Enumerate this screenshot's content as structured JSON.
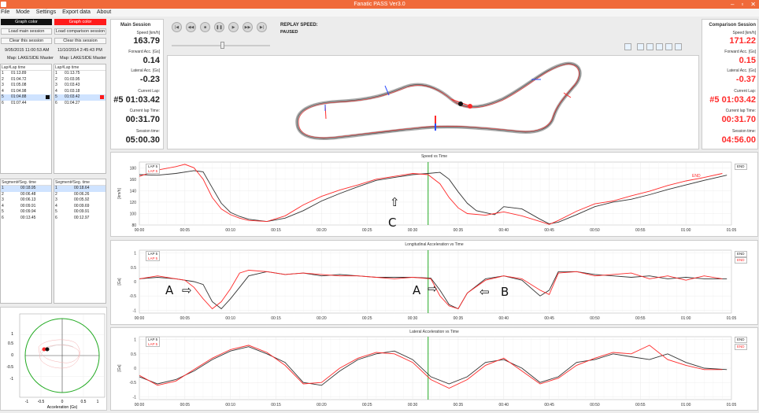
{
  "window": {
    "title": "Fanatic PASS Ver3.0",
    "controls": [
      "–",
      "▫",
      "✕"
    ]
  },
  "menu": [
    "File",
    "Mode",
    "Settings",
    "Export data",
    "About"
  ],
  "left": {
    "graph_color_main": "Graph color",
    "graph_color_comp": "Graph color",
    "load_main": "Load main session",
    "load_comp": "Load comparison session",
    "clear_main": "Clear this session",
    "clear_comp": "Clear this session",
    "main_date": "9/05/2015 11:00:53 AM",
    "comp_date": "11/10/2014 2:45:43 PM",
    "main_map": "Map: LAKESIDE Master",
    "comp_map": "Map: LAKESIDE Master",
    "lap_header_num": "Lap#",
    "lap_header_time": "Lap time",
    "main_laps": [
      {
        "n": "1",
        "t": "01:13.89"
      },
      {
        "n": "2",
        "t": "01:04.72"
      },
      {
        "n": "3",
        "t": "01:05.08"
      },
      {
        "n": "4",
        "t": "01:04.98"
      },
      {
        "n": "5",
        "t": "01:04.88"
      },
      {
        "n": "6",
        "t": "01:07.44"
      }
    ],
    "comp_laps": [
      {
        "n": "1",
        "t": "01:13.75"
      },
      {
        "n": "2",
        "t": "01:03.95"
      },
      {
        "n": "3",
        "t": "01:03.43"
      },
      {
        "n": "4",
        "t": "01:03.18"
      },
      {
        "n": "5",
        "t": "01:03.42"
      },
      {
        "n": "6",
        "t": "01:04.27"
      }
    ],
    "seg_header_num": "Segment#",
    "seg_header_time": "Seg. time",
    "main_segs": [
      {
        "n": "1",
        "t": "00:18.95"
      },
      {
        "n": "2",
        "t": "00:06.48"
      },
      {
        "n": "3",
        "t": "00:06.13"
      },
      {
        "n": "4",
        "t": "00:09.91"
      },
      {
        "n": "5",
        "t": "00:09.94"
      },
      {
        "n": "6",
        "t": "00:13.45"
      }
    ],
    "comp_segs": [
      {
        "n": "1",
        "t": "00:18.64"
      },
      {
        "n": "2",
        "t": "00:06.26"
      },
      {
        "n": "3",
        "t": "00:05.92"
      },
      {
        "n": "4",
        "t": "00:09.69"
      },
      {
        "n": "5",
        "t": "00:09.91"
      },
      {
        "n": "6",
        "t": "00:12.97"
      }
    ],
    "gg_axis": [
      "1",
      "0.5",
      "0",
      "-0.5",
      "-1"
    ],
    "gg_xaxis": [
      "-1",
      "-0.5",
      "0",
      "0.5",
      "1"
    ],
    "gg_xlabel": "Acceleration (Gs)"
  },
  "main_session": {
    "title": "Main Session",
    "speed_lbl": "Speed [km/h]",
    "speed": "163.79",
    "fwd_lbl": "Forward Acc. [Gs]",
    "fwd": "0.14",
    "lat_lbl": "Lateral Acc. [Gs]",
    "lat": "-0.23",
    "lap_lbl": "Current Lap:",
    "lap": "#5 01:03.42",
    "laptime_lbl": "Current lap Time:",
    "laptime": "00:31.70",
    "session_lbl": "Session time:",
    "session": "05:00.30"
  },
  "comp_session": {
    "title": "Comparison Session",
    "speed_lbl": "Speed [km/h]",
    "speed": "171.22",
    "fwd_lbl": "Forward Acc. [Gs]",
    "fwd": "0.15",
    "lat_lbl": "Lateral Acc. [Gs]",
    "lat": "-0.37",
    "lap_lbl": "Current Lap:",
    "lap": "#5 01:03.42",
    "laptime_lbl": "Current lap Time:",
    "laptime": "00:31.70",
    "session_lbl": "Session time:",
    "session": "04:56.00"
  },
  "replay": {
    "speed_label": "REPLAY SPEED:",
    "state": "PAUSED"
  },
  "colors": {
    "main": "#333333",
    "comp": "#ff2a2a",
    "cursor": "#22aa22",
    "titlebar": "#f06a3a"
  },
  "charts": {
    "speed_title": "Speed vs Time",
    "long_title": "Longitudinal Acceleration vs Time",
    "lat_title": "Lateral Acceleration vs Time",
    "legend_main": "LAP 5",
    "legend_comp": "LAP 5",
    "end": "END",
    "speed_unit": "[km/h]",
    "g_unit": "[Gs]",
    "speed_yticks": [
      "180",
      "160",
      "140",
      "120",
      "100",
      "80"
    ],
    "long_yticks": [
      "1",
      "0.5",
      "0",
      "-0.5",
      "-1"
    ],
    "lat_yticks": [
      "1",
      "0.5",
      "0",
      "-0.5",
      "-1"
    ],
    "xticks": [
      "00:00",
      "00:05",
      "00:10",
      "00:15",
      "00:20",
      "00:25",
      "00:30",
      "00:35",
      "00:40",
      "00:45",
      "00:50",
      "00:55",
      "01:00",
      "01:05"
    ]
  },
  "annotations": {
    "c": "C",
    "a1": "A",
    "a2": "A",
    "b": "B"
  },
  "chart_data": [
    {
      "type": "line",
      "title": "Speed vs Time",
      "ylabel": "[km/h]",
      "ylim": [
        80,
        190
      ],
      "xlim": [
        0,
        65
      ],
      "series": [
        {
          "name": "LAP 5",
          "color": "#333333",
          "x": [
            0,
            2,
            4,
            6,
            7,
            8,
            9,
            10,
            11,
            12,
            14,
            16,
            18,
            20,
            22,
            24,
            26,
            28,
            30,
            31.7,
            33,
            34,
            35,
            36,
            37,
            39,
            40,
            42,
            44,
            45,
            46,
            48,
            50,
            52,
            54,
            56,
            58,
            60,
            62,
            64.5
          ],
          "y": [
            168,
            167,
            170,
            175,
            173,
            145,
            118,
            102,
            95,
            90,
            86,
            92,
            105,
            122,
            135,
            147,
            158,
            163,
            168,
            170,
            172,
            160,
            138,
            118,
            105,
            98,
            112,
            108,
            90,
            82,
            85,
            98,
            112,
            120,
            125,
            133,
            142,
            150,
            158,
            167
          ]
        },
        {
          "name": "LAP 5",
          "color": "#ff2a2a",
          "x": [
            0,
            2,
            4,
            5,
            6,
            7,
            8,
            9,
            10,
            11,
            12,
            14,
            16,
            18,
            20,
            22,
            24,
            26,
            28,
            30,
            31.7,
            33,
            34,
            35,
            36,
            38,
            40,
            42,
            44,
            45,
            46,
            48,
            50,
            52,
            54,
            56,
            58,
            60,
            62,
            64
          ],
          "y": [
            165,
            176,
            182,
            186,
            180,
            160,
            128,
            108,
            98,
            92,
            88,
            86,
            96,
            115,
            130,
            141,
            150,
            160,
            165,
            170,
            168,
            152,
            128,
            110,
            100,
            97,
            103,
            96,
            86,
            81,
            88,
            104,
            117,
            122,
            131,
            139,
            149,
            157,
            163,
            170
          ]
        }
      ]
    },
    {
      "type": "line",
      "title": "Longitudinal Acceleration vs Time",
      "ylabel": "[Gs]",
      "ylim": [
        -1.1,
        1.1
      ],
      "xlim": [
        0,
        65
      ],
      "series": [
        {
          "name": "LAP 5",
          "color": "#333333",
          "x": [
            0,
            2,
            4,
            6,
            7,
            8,
            9,
            10,
            11,
            12,
            14,
            16,
            18,
            20,
            22,
            24,
            26,
            28,
            30,
            32,
            33,
            34,
            35,
            36,
            38,
            40,
            42,
            44,
            45,
            46,
            48,
            50,
            52,
            54,
            56,
            58,
            60,
            62,
            64.5
          ],
          "y": [
            0.1,
            0.15,
            0.1,
            0.0,
            -0.1,
            -0.7,
            -0.95,
            -0.6,
            -0.2,
            0.2,
            0.35,
            0.25,
            0.3,
            0.2,
            0.25,
            0.2,
            0.15,
            0.15,
            0.15,
            0.12,
            -0.3,
            -0.8,
            -0.95,
            -0.4,
            0.1,
            0.2,
            0.05,
            -0.5,
            -0.3,
            0.35,
            0.35,
            0.25,
            0.2,
            0.15,
            0.2,
            0.1,
            0.15,
            0.1,
            0.1
          ]
        },
        {
          "name": "LAP 5",
          "color": "#ff2a2a",
          "x": [
            0,
            2,
            4,
            5,
            6,
            7,
            8,
            9,
            10,
            11,
            12,
            14,
            16,
            18,
            20,
            22,
            24,
            26,
            28,
            30,
            32,
            33,
            34,
            35,
            36,
            38,
            40,
            42,
            44,
            45,
            46,
            48,
            50,
            52,
            54,
            56,
            58,
            60,
            62,
            64
          ],
          "y": [
            0.1,
            0.2,
            0.1,
            0.05,
            -0.2,
            -0.6,
            -0.95,
            -0.7,
            -0.25,
            0.3,
            0.4,
            0.35,
            0.25,
            0.3,
            0.25,
            0.2,
            0.2,
            0.15,
            0.1,
            0.15,
            0.1,
            -0.5,
            -0.85,
            -0.95,
            -0.4,
            0.05,
            0.2,
            0.1,
            -0.3,
            -0.45,
            0.3,
            0.35,
            0.2,
            0.25,
            0.3,
            0.1,
            0.2,
            0.05,
            0.2,
            0.1
          ]
        }
      ]
    },
    {
      "type": "line",
      "title": "Lateral Acceleration vs Time",
      "ylabel": "[Gs]",
      "ylim": [
        -1.1,
        1.1
      ],
      "xlim": [
        0,
        65
      ],
      "series": [
        {
          "name": "LAP 5",
          "color": "#333333",
          "x": [
            0,
            2,
            4,
            6,
            8,
            10,
            12,
            14,
            16,
            18,
            20,
            22,
            24,
            26,
            28,
            30,
            32,
            34,
            36,
            38,
            40,
            42,
            44,
            46,
            48,
            50,
            52,
            54,
            56,
            58,
            60,
            62,
            64.5
          ],
          "y": [
            -0.3,
            -0.55,
            -0.4,
            -0.1,
            0.3,
            0.6,
            0.75,
            0.5,
            0.2,
            -0.5,
            -0.6,
            -0.1,
            0.3,
            0.5,
            0.6,
            0.3,
            -0.3,
            -0.55,
            -0.3,
            0.2,
            0.3,
            0.0,
            -0.5,
            -0.3,
            0.2,
            0.3,
            0.5,
            0.4,
            0.3,
            0.5,
            0.2,
            0.0,
            -0.05
          ]
        },
        {
          "name": "LAP 5",
          "color": "#ff2a2a",
          "x": [
            0,
            2,
            4,
            6,
            8,
            10,
            12,
            14,
            16,
            18,
            20,
            22,
            24,
            26,
            28,
            30,
            32,
            34,
            36,
            38,
            40,
            42,
            44,
            46,
            48,
            50,
            52,
            54,
            56,
            58,
            60,
            62,
            64
          ],
          "y": [
            -0.25,
            -0.6,
            -0.45,
            -0.05,
            0.35,
            0.65,
            0.8,
            0.55,
            0.1,
            -0.55,
            -0.5,
            0.0,
            0.35,
            0.55,
            0.5,
            0.2,
            -0.4,
            -0.7,
            -0.4,
            0.1,
            0.35,
            -0.1,
            -0.55,
            -0.35,
            0.1,
            0.35,
            0.55,
            0.5,
            0.8,
            0.3,
            0.1,
            -0.05,
            -0.05
          ]
        }
      ]
    }
  ]
}
